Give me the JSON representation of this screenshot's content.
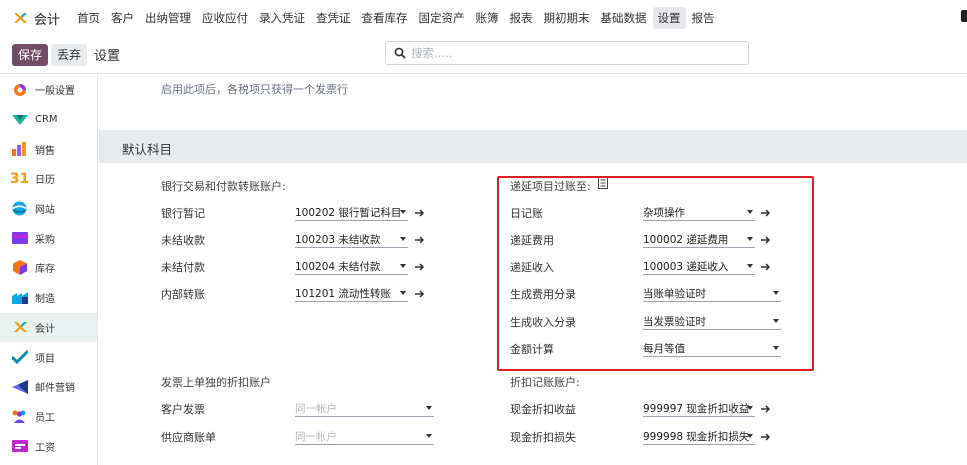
{
  "navbar": {
    "app_name": "会计",
    "menu": [
      "首页",
      "客户",
      "出纳管理",
      "应收应付",
      "录入凭证",
      "查凭证",
      "查看库存",
      "固定资产",
      "账簿",
      "报表",
      "期初期末",
      "基础数据",
      "设置",
      "报告"
    ],
    "active_menu": "设置"
  },
  "control_panel": {
    "save_label": "保存",
    "discard_label": "丢弃",
    "breadcrumb": "设置",
    "search_placeholder": "搜索....."
  },
  "sidebar": {
    "items": [
      {
        "label": "一般设置",
        "icon": "general-settings-icon"
      },
      {
        "label": "CRM",
        "icon": "crm-icon"
      },
      {
        "label": "销售",
        "icon": "sales-icon"
      },
      {
        "label": "日历",
        "icon": "calendar-icon"
      },
      {
        "label": "网站",
        "icon": "website-icon"
      },
      {
        "label": "采购",
        "icon": "purchase-icon"
      },
      {
        "label": "库存",
        "icon": "inventory-icon"
      },
      {
        "label": "制造",
        "icon": "manufacturing-icon"
      },
      {
        "label": "会计",
        "icon": "accounting-icon"
      },
      {
        "label": "项目",
        "icon": "project-icon"
      },
      {
        "label": "邮件营销",
        "icon": "email-marketing-icon"
      },
      {
        "label": "员工",
        "icon": "employees-icon"
      },
      {
        "label": "工资",
        "icon": "payroll-icon"
      }
    ],
    "calendar_day": "31",
    "active": "会计"
  },
  "main": {
    "hint": "启用此项后，各税项只获得一个发票行",
    "section_title": "默认科目",
    "left_group": {
      "heading": "银行交易和付款转账账户:",
      "rows": [
        {
          "label": "银行暂记",
          "value": "100202 银行暂记科目"
        },
        {
          "label": "未结收款",
          "value": "100203 未结收款"
        },
        {
          "label": "未结付款",
          "value": "100204 未结付款"
        },
        {
          "label": "内部转账",
          "value": "101201 流动性转账"
        }
      ]
    },
    "right_group": {
      "heading": "递延项目过账至:",
      "rows": [
        {
          "label": "日记账",
          "value": "杂项操作"
        },
        {
          "label": "递延费用",
          "value": "100002 递延费用"
        },
        {
          "label": "递延收入",
          "value": "100003 递延收入"
        },
        {
          "label": "生成费用分录",
          "value": "当账单验证时"
        },
        {
          "label": "生成收入分录",
          "value": "当发票验证时"
        },
        {
          "label": "金额计算",
          "value": "每月等值"
        }
      ]
    },
    "discount_left": {
      "heading": "发票上单独的折扣账户",
      "rows": [
        {
          "label": "客户发票",
          "placeholder": "同一帐户"
        },
        {
          "label": "供应商账单",
          "placeholder": "同一帐户"
        }
      ]
    },
    "discount_right": {
      "heading": "折扣记账账户:",
      "rows": [
        {
          "label": "现金折扣收益",
          "value": "999997 现金折扣收益"
        },
        {
          "label": "现金折扣损失",
          "value": "999998 现金折扣损失"
        }
      ]
    }
  },
  "colors": {
    "brand": "#714b67",
    "highlight": "#e01e25",
    "section_bg": "#e9ecef"
  }
}
